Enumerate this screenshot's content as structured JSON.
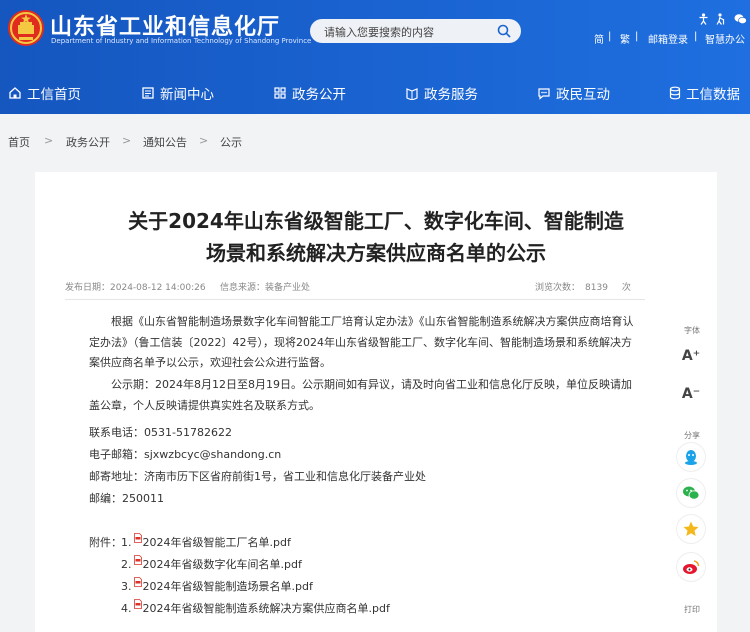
{
  "header": {
    "site_title": "山东省工业和信息化厅",
    "site_title_en": "Department of Industry and Information Technology of Shandong Province",
    "search_placeholder": "请输入您要搜索的内容",
    "top_links": {
      "simplified": "简",
      "traditional": "繁",
      "login": "邮箱登录",
      "smart_office": "智慧办公"
    }
  },
  "nav": {
    "items": [
      {
        "label": "工信首页",
        "icon": "home-icon"
      },
      {
        "label": "新闻中心",
        "icon": "news-icon"
      },
      {
        "label": "政务公开",
        "icon": "open-gov-icon"
      },
      {
        "label": "政务服务",
        "icon": "service-icon"
      },
      {
        "label": "政民互动",
        "icon": "chat-icon"
      },
      {
        "label": "工信数据",
        "icon": "database-icon"
      }
    ]
  },
  "breadcrumb": {
    "items": [
      "首页",
      "政务公开",
      "通知公告",
      "公示"
    ],
    "separator": ">"
  },
  "article": {
    "title_line1": "关于2024年山东省级智能工厂、数字化车间、智能制造",
    "title_line2": "场景和系统解决方案供应商名单的公示",
    "meta": {
      "publish_label": "发布日期：",
      "publish_time": "2024-08-12 14:00:26",
      "source_label": "信息来源：",
      "source": "装备产业处",
      "views_label": "浏览次数：",
      "views": "8139",
      "views_unit": "次"
    },
    "paragraph1": "根据《山东省智能制造场景数字化车间智能工厂培育认定办法》《山东省智能制造系统解决方案供应商培育认定办法》（鲁工信装〔2022〕42号），现将2024年山东省级智能工厂、数字化车间、智能制造场景和系统解决方案供应商名单予以公示，欢迎社会公众进行监督。",
    "paragraph2": "公示期：2024年8月12日至8月19日。公示期间如有异议，请及时向省工业和信息化厅反映，单位反映请加盖公章，个人反映请提供真实姓名及联系方式。",
    "contact": {
      "phone": "联系电话：0531-51782622",
      "email": "电子邮箱：sjxwzbcyc@shandong.cn",
      "address": "邮寄地址：济南市历下区省府前街1号，省工业和信息化厅装备产业处",
      "postcode": "邮编：250011"
    },
    "attachments_label": "附件：",
    "attachments": [
      {
        "num": "1.",
        "name": "2024年省级智能工厂名单.pdf"
      },
      {
        "num": "2.",
        "name": "2024年省级数字化车间名单.pdf"
      },
      {
        "num": "3.",
        "name": "2024年省级智能制造场景名单.pdf"
      },
      {
        "num": "4.",
        "name": "2024年省级智能制造系统解决方案供应商名单.pdf"
      }
    ]
  },
  "sidebar": {
    "font_label": "字体",
    "font_increase": "A⁺",
    "font_decrease": "A⁻",
    "share_label": "分享",
    "print_label": "打印",
    "share_icons": [
      "qq-icon",
      "wechat-icon",
      "favorite-icon",
      "weibo-icon"
    ]
  },
  "colors": {
    "header_blue": "#1a64d2",
    "background": "#f2f3f5",
    "pdf_red": "#d9342b"
  }
}
